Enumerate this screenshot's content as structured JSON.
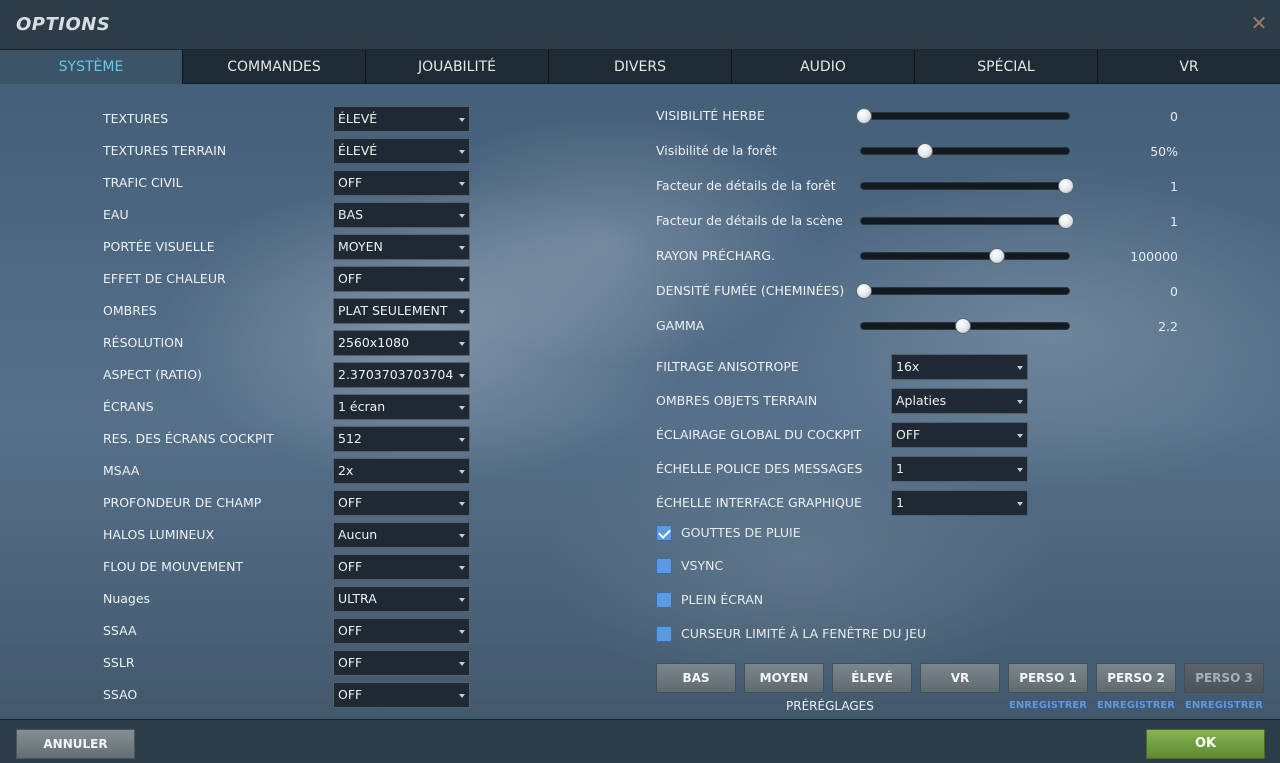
{
  "window": {
    "title": "OPTIONS",
    "close_symbol": "✕"
  },
  "tabs": [
    "SYSTÈME",
    "COMMANDES",
    "JOUABILITÉ",
    "DIVERS",
    "AUDIO",
    "SPÉCIAL",
    "VR"
  ],
  "left_settings": [
    {
      "label": "TEXTURES",
      "value": "ÉLEVÉ"
    },
    {
      "label": "TEXTURES TERRAIN",
      "value": "ÉLEVÉ"
    },
    {
      "label": "TRAFIC CIVIL",
      "value": "OFF"
    },
    {
      "label": "EAU",
      "value": "BAS"
    },
    {
      "label": "PORTÉE VISUELLE",
      "value": "MOYEN"
    },
    {
      "label": "EFFET DE CHALEUR",
      "value": "OFF"
    },
    {
      "label": "OMBRES",
      "value": "PLAT SEULEMENT"
    },
    {
      "label": "RÉSOLUTION",
      "value": "2560x1080"
    },
    {
      "label": "ASPECT (RATIO)",
      "value": "2.3703703703704"
    },
    {
      "label": "ÉCRANS",
      "value": "1 écran"
    },
    {
      "label": "RES. DES ÉCRANS COCKPIT",
      "value": "512"
    },
    {
      "label": "MSAA",
      "value": "2x"
    },
    {
      "label": "PROFONDEUR DE CHAMP",
      "value": "OFF"
    },
    {
      "label": "HALOS LUMINEUX",
      "value": "Aucun"
    },
    {
      "label": "FLOU DE MOUVEMENT",
      "value": "OFF"
    },
    {
      "label": "Nuages",
      "value": "ULTRA"
    },
    {
      "label": "SSAA",
      "value": "OFF"
    },
    {
      "label": "SSLR",
      "value": "OFF"
    },
    {
      "label": "SSAO",
      "value": "OFF"
    }
  ],
  "sliders": [
    {
      "label": "VISIBILITÉ HERBE",
      "value": "0",
      "fraction": 0.0
    },
    {
      "label": "Visibilité de la forêt",
      "value": "50%",
      "fraction": 0.3
    },
    {
      "label": "Facteur de détails de la forêt",
      "value": "1",
      "fraction": 1.0
    },
    {
      "label": "Facteur de détails de la scène",
      "value": "1",
      "fraction": 1.0
    },
    {
      "label": "RAYON PRÉCHARG.",
      "value": "100000",
      "fraction": 0.66
    },
    {
      "label": "DENSITÉ FUMÉE (CHEMINÉES)",
      "value": "0",
      "fraction": 0.0
    },
    {
      "label": "GAMMA",
      "value": "2.2",
      "fraction": 0.49
    }
  ],
  "right_settings": [
    {
      "label": "FILTRAGE ANISOTROPE",
      "value": "16x"
    },
    {
      "label": "OMBRES OBJETS TERRAIN",
      "value": "Aplaties"
    },
    {
      "label": "ÉCLAIRAGE GLOBAL DU COCKPIT",
      "value": "OFF"
    },
    {
      "label": "ÉCHELLE POLICE DES MESSAGES",
      "value": "1"
    },
    {
      "label": "ÉCHELLE INTERFACE GRAPHIQUE",
      "value": "1"
    }
  ],
  "checkboxes": [
    {
      "label": "GOUTTES DE PLUIE",
      "checked": true
    },
    {
      "label": "VSYNC",
      "checked": false
    },
    {
      "label": "PLEIN ÉCRAN",
      "checked": false
    },
    {
      "label": "CURSEUR LIMITÉ À LA FENÊTRE DU JEU",
      "checked": false
    }
  ],
  "presets": {
    "buttons": [
      "BAS",
      "MOYEN",
      "ÉLEVÉ",
      "VR",
      "PERSO 1",
      "PERSO 2",
      "PERSO 3"
    ],
    "save_label": "ENREGISTRER",
    "group_label": "PRÉRÉGLAGES"
  },
  "footer": {
    "cancel_label": "ANNULER",
    "ok_label": "OK"
  }
}
